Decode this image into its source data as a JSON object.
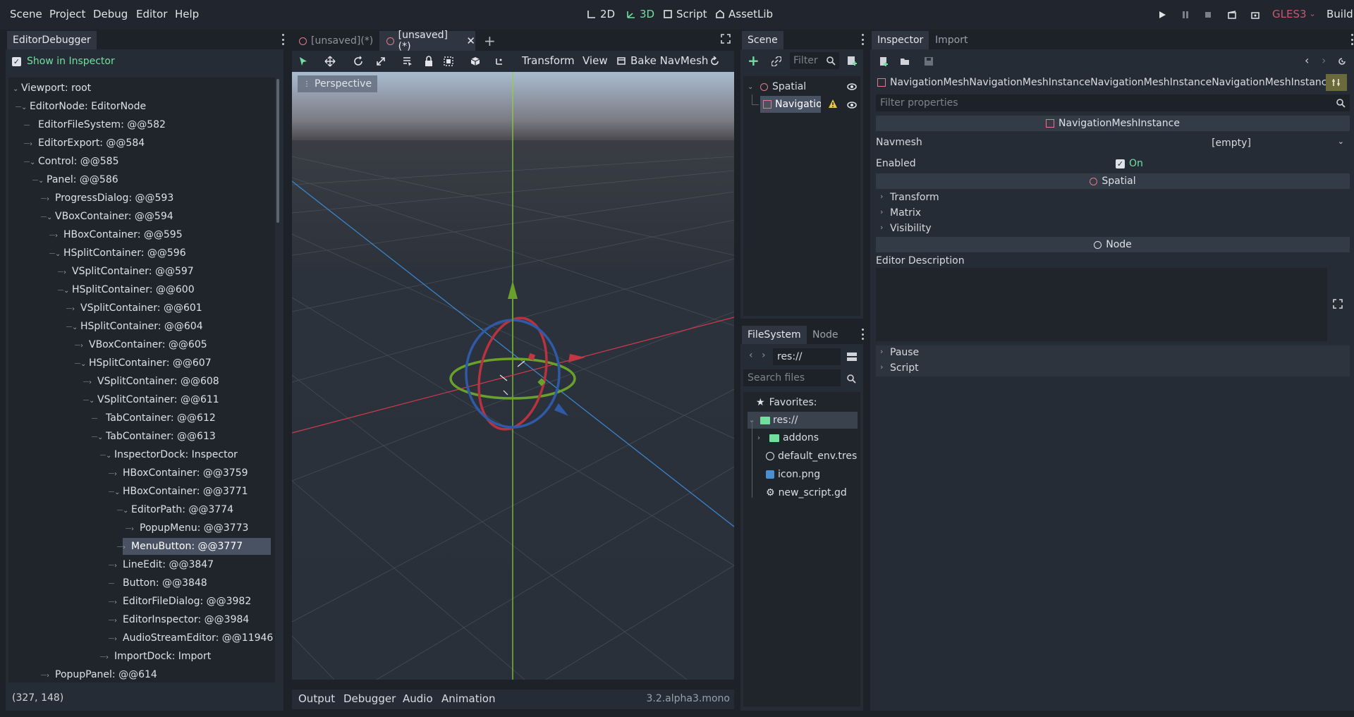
{
  "menu": {
    "scene": "Scene",
    "project": "Project",
    "debug": "Debug",
    "editor": "Editor",
    "help": "Help"
  },
  "workspaces": {
    "w2d": "2D",
    "w3d": "3D",
    "script": "Script",
    "assetlib": "AssetLib"
  },
  "renderer": "GLES3",
  "build": "Build",
  "debugger": {
    "tab": "EditorDebugger",
    "show_in_inspector": "Show in Inspector",
    "status": "(327, 148)",
    "nodes": [
      {
        "label": "Viewport: root",
        "depth": 0,
        "open": true
      },
      {
        "label": "EditorNode: EditorNode",
        "depth": 1,
        "open": true
      },
      {
        "label": "EditorFileSystem: @@582",
        "depth": 2,
        "open": null
      },
      {
        "label": "EditorExport: @@584",
        "depth": 2,
        "open": false
      },
      {
        "label": "Control: @@585",
        "depth": 2,
        "open": true
      },
      {
        "label": "Panel: @@586",
        "depth": 3,
        "open": true
      },
      {
        "label": "ProgressDialog: @@593",
        "depth": 4,
        "open": false
      },
      {
        "label": "VBoxContainer: @@594",
        "depth": 4,
        "open": true
      },
      {
        "label": "HBoxContainer: @@595",
        "depth": 5,
        "open": false
      },
      {
        "label": "HSplitContainer: @@596",
        "depth": 5,
        "open": true
      },
      {
        "label": "VSplitContainer: @@597",
        "depth": 6,
        "open": false
      },
      {
        "label": "HSplitContainer: @@600",
        "depth": 6,
        "open": true
      },
      {
        "label": "VSplitContainer: @@601",
        "depth": 7,
        "open": false
      },
      {
        "label": "HSplitContainer: @@604",
        "depth": 7,
        "open": true
      },
      {
        "label": "VBoxContainer: @@605",
        "depth": 8,
        "open": false
      },
      {
        "label": "HSplitContainer: @@607",
        "depth": 8,
        "open": true
      },
      {
        "label": "VSplitContainer: @@608",
        "depth": 9,
        "open": false
      },
      {
        "label": "VSplitContainer: @@611",
        "depth": 9,
        "open": true
      },
      {
        "label": "TabContainer: @@612",
        "depth": 10,
        "open": null
      },
      {
        "label": "TabContainer: @@613",
        "depth": 10,
        "open": true
      },
      {
        "label": "InspectorDock: Inspector",
        "depth": 11,
        "open": true
      },
      {
        "label": "HBoxContainer: @@3759",
        "depth": 12,
        "open": false
      },
      {
        "label": "HBoxContainer: @@3771",
        "depth": 12,
        "open": true
      },
      {
        "label": "EditorPath: @@3774",
        "depth": 13,
        "open": true
      },
      {
        "label": "PopupMenu: @@3773",
        "depth": 14,
        "open": false
      },
      {
        "label": "MenuButton: @@3777",
        "depth": 13,
        "open": false,
        "selected": true
      },
      {
        "label": "LineEdit: @@3847",
        "depth": 12,
        "open": false
      },
      {
        "label": "Button: @@3848",
        "depth": 12,
        "open": null
      },
      {
        "label": "EditorFileDialog: @@3982",
        "depth": 12,
        "open": false
      },
      {
        "label": "EditorInspector: @@3984",
        "depth": 12,
        "open": false
      },
      {
        "label": "AudioStreamEditor: @@11946",
        "depth": 12,
        "open": false
      },
      {
        "label": "ImportDock: Import",
        "depth": 11,
        "open": false
      },
      {
        "label": "PopupPanel: @@614",
        "depth": 4,
        "open": false
      }
    ]
  },
  "editor_tabs": [
    {
      "label": "[unsaved](*)",
      "active": false
    },
    {
      "label": "[unsaved](*)",
      "active": true
    }
  ],
  "viewport_toolbar": {
    "transform": "Transform",
    "view": "View",
    "bake": "Bake NavMesh"
  },
  "viewport": {
    "perspective": "Perspective"
  },
  "bottom": {
    "output": "Output",
    "debugger": "Debugger",
    "audio": "Audio",
    "animation": "Animation",
    "version": "3.2.alpha3.mono"
  },
  "scene_dock": {
    "tab": "Scene",
    "filter_placeholder": "Filter",
    "nodes": [
      {
        "label": "Spatial"
      },
      {
        "label": "Navigatio"
      }
    ]
  },
  "fs_dock": {
    "tabs": [
      "FileSystem",
      "Node"
    ],
    "path": "res://",
    "search_placeholder": "Search files",
    "favorites": "Favorites:",
    "root": "res://",
    "items": [
      "addons",
      "default_env.tres",
      "icon.png",
      "new_script.gd"
    ]
  },
  "inspector": {
    "tabs": [
      "Inspector",
      "Import"
    ],
    "object": "NavigationMeshNavigationMeshInstanceNavigationMeshInstanceNavigationMeshInstance",
    "filter_placeholder": "Filter properties",
    "sections": {
      "navmesh_instance": "NavigationMeshInstance",
      "spatial": "Spatial",
      "node": "Node"
    },
    "props": {
      "navmesh_label": "Navmesh",
      "navmesh_value": "[empty]",
      "enabled_label": "Enabled",
      "enabled_value": "On",
      "transform": "Transform",
      "matrix": "Matrix",
      "visibility": "Visibility",
      "editor_description": "Editor Description",
      "pause": "Pause",
      "script": "Script"
    }
  },
  "colors": {
    "accent_green": "#71e09f",
    "gles_red": "#c9576d",
    "selection": "#495263"
  }
}
